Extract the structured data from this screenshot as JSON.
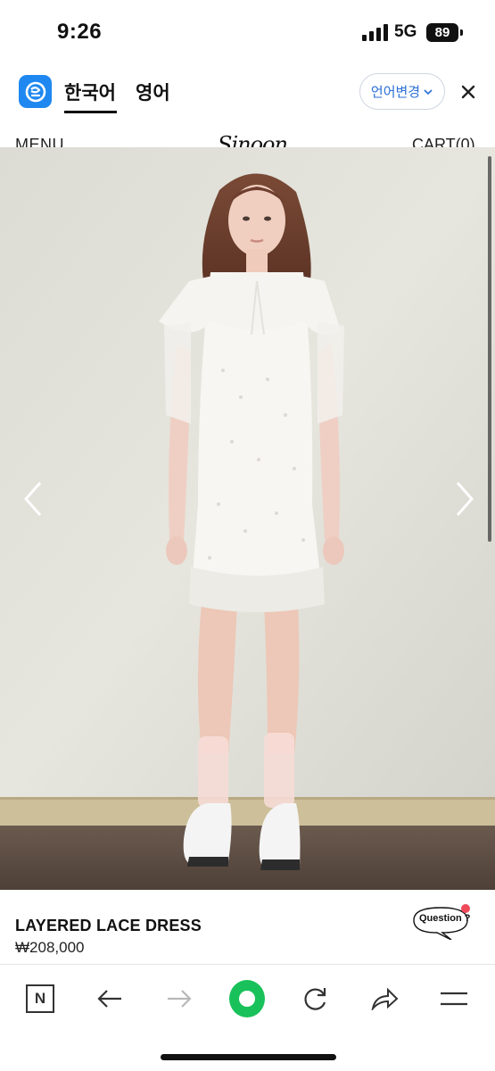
{
  "status_bar": {
    "time": "9:26",
    "network": "5G",
    "battery": "89"
  },
  "translate_bar": {
    "source_language": "한국어",
    "target_language": "영어",
    "change_language_label": "언어변경",
    "app_icon": "translate-app-icon",
    "accent_color": "#2b6fd6"
  },
  "site_header": {
    "menu_label": "MENU",
    "logo_text": "Sinoon",
    "cart_label": "CART(0)"
  },
  "product": {
    "image_icon": "product-photo-white-lace-dress",
    "name": "LAYERED LACE DRESS",
    "price": "₩208,000",
    "question_label": "Question ?",
    "question_badge_color": "#ef4a5a"
  },
  "browser_toolbar": {
    "items": [
      {
        "icon": "naver-n-icon",
        "glyph": "N"
      },
      {
        "icon": "back-arrow-icon"
      },
      {
        "icon": "forward-arrow-icon"
      },
      {
        "icon": "green-home-circle-icon"
      },
      {
        "icon": "refresh-icon"
      },
      {
        "icon": "share-icon"
      },
      {
        "icon": "menu-lines-icon"
      }
    ],
    "home_color": "#19c15a"
  }
}
